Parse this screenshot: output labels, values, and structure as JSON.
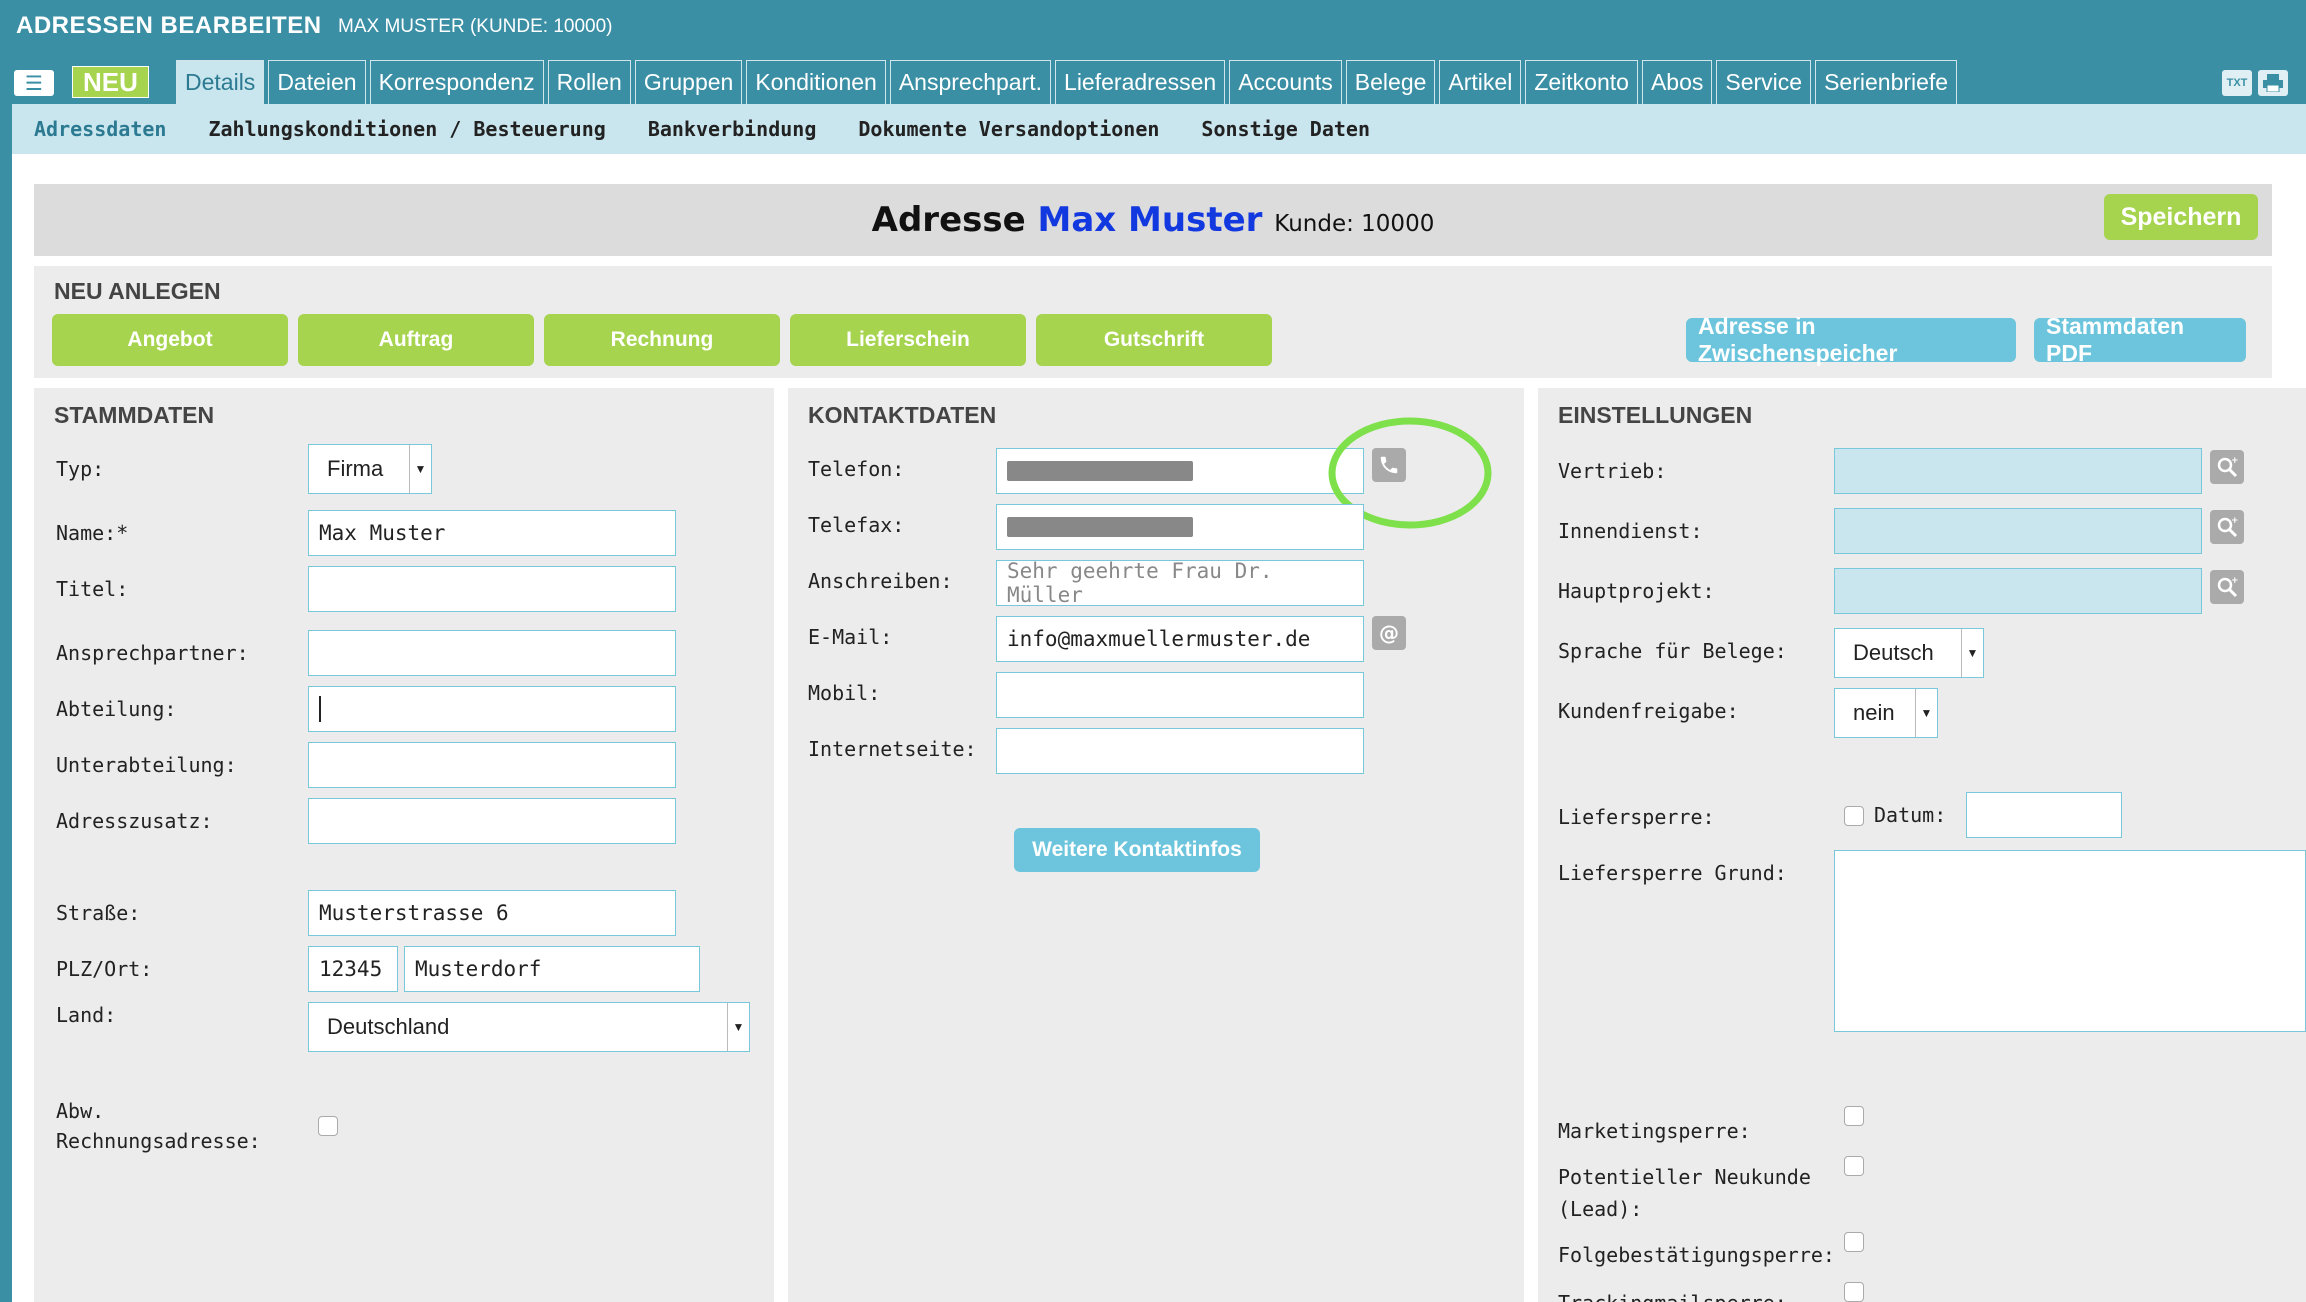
{
  "header": {
    "title_a": "ADRESSEN",
    "title_b": "BEARBEITEN",
    "subtitle": "MAX MUSTER (KUNDE: 10000)"
  },
  "toolbar": {
    "neu_label": "NEU",
    "txt_label": "TXT"
  },
  "tabs": [
    "Details",
    "Dateien",
    "Korrespondenz",
    "Rollen",
    "Gruppen",
    "Konditionen",
    "Ansprechpart.",
    "Lieferadressen",
    "Accounts",
    "Belege",
    "Artikel",
    "Zeitkonto",
    "Abos",
    "Service",
    "Serienbriefe"
  ],
  "subtabs": [
    "Adressdaten",
    "Zahlungskonditionen / Besteuerung",
    "Bankverbindung",
    "Dokumente Versandoptionen",
    "Sonstige Daten"
  ],
  "page": {
    "title_prefix": "Adresse",
    "title_name": "Max Muster",
    "kunde": "Kunde: 10000",
    "save_label": "Speichern"
  },
  "neu_anlegen": {
    "title": "NEU ANLEGEN",
    "buttons": [
      "Angebot",
      "Auftrag",
      "Rechnung",
      "Lieferschein",
      "Gutschrift"
    ],
    "zwischenspeicher_label": "Adresse in Zwischenspeicher",
    "stammdaten_pdf_label": "Stammdaten PDF"
  },
  "stammdaten": {
    "title": "STAMMDATEN",
    "typ_label": "Typ:",
    "typ_value": "Firma",
    "name_label": "Name:*",
    "name_value": "Max Muster",
    "titel_label": "Titel:",
    "ansprechpartner_label": "Ansprechpartner:",
    "abteilung_label": "Abteilung:",
    "unterabteilung_label": "Unterabteilung:",
    "adresszusatz_label": "Adresszusatz:",
    "strasse_label": "Straße:",
    "strasse_value": "Musterstrasse 6",
    "plzort_label": "PLZ/Ort:",
    "plz_value": "12345",
    "ort_value": "Musterdorf",
    "land_label": "Land:",
    "land_value": "Deutschland",
    "abw_label_1": "Abw.",
    "abw_label_2": "Rechnungsadresse:"
  },
  "kontaktdaten": {
    "title": "KONTAKTDATEN",
    "telefon_label": "Telefon:",
    "telefax_label": "Telefax:",
    "anschreiben_label": "Anschreiben:",
    "anschreiben_placeholder": "Sehr geehrte Frau Dr. Müller",
    "email_label": "E-Mail:",
    "email_value": "info@maxmuellermuster.de",
    "mobil_label": "Mobil:",
    "internet_label": "Internetseite:",
    "weitere_label": "Weitere Kontaktinfos"
  },
  "einstellungen": {
    "title": "EINSTELLUNGEN",
    "vertrieb_label": "Vertrieb:",
    "innendienst_label": "Innendienst:",
    "hauptprojekt_label": "Hauptprojekt:",
    "sprache_label": "Sprache für Belege:",
    "sprache_value": "Deutsch",
    "freigabe_label": "Kundenfreigabe:",
    "freigabe_value": "nein",
    "liefersperre_label": "Liefersperre:",
    "datum_label": "Datum:",
    "grund_label": "Liefersperre Grund:",
    "marketing_label": "Marketingsperre:",
    "lead_label_1": "Potentieller Neukunde",
    "lead_label_2": "(Lead):",
    "folge_label": "Folgebestätigungsperre:",
    "tracking_label": "Trackingmailsperre:"
  },
  "colors": {
    "header_bg": "#3a8fa5",
    "accent_green": "#a6d44e",
    "accent_teal": "#6cc5dc",
    "highlight": "#7ee04a",
    "name_blue": "#1238e0"
  }
}
